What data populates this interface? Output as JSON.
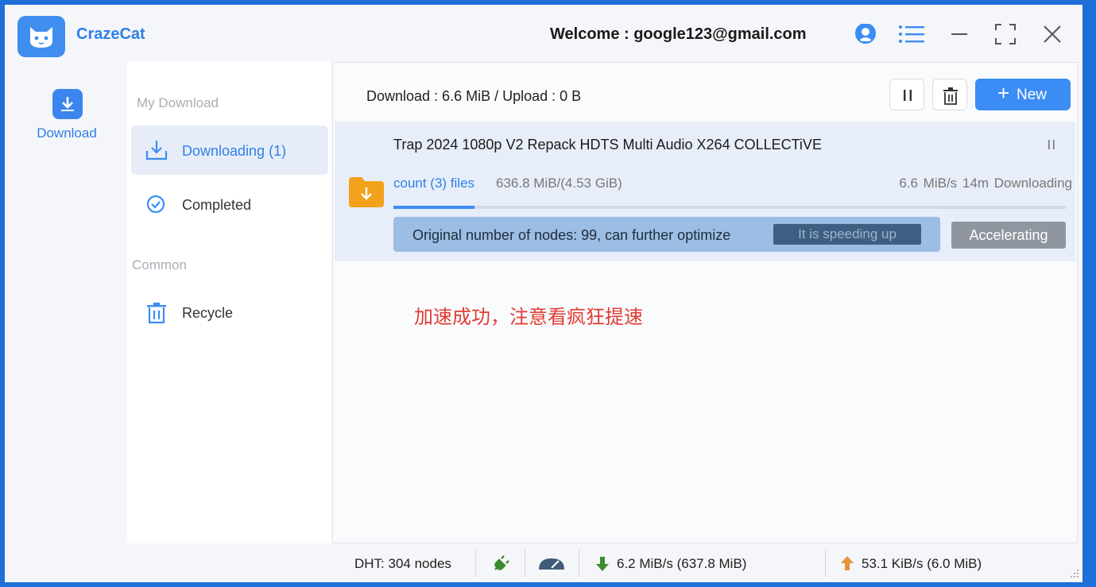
{
  "app": {
    "name": "CrazeCat",
    "welcome": "Welcome : google123@gmail.com"
  },
  "rail": {
    "download_label": "Download"
  },
  "sidebar": {
    "section_my": "My Download",
    "items": [
      {
        "label": "Downloading (1)",
        "active": true
      },
      {
        "label": "Completed"
      }
    ],
    "section_common": "Common",
    "recycle": "Recycle"
  },
  "main": {
    "stats": "Download : 6.6 MiB / Upload : 0 B",
    "new_label": "New"
  },
  "task": {
    "title": "Trap 2024 1080p V2 Repack HDTS Multi Audio X264 COLLECTiVE",
    "files_link": "count (3) files",
    "size": "636.8 MiB/(4.53 GiB)",
    "speed_status": "6.6 MiB/s 14m Downloading",
    "progress": 0.12,
    "accel_text": "Original number of nodes: 99, can further optimize",
    "speeding_badge": "It is speeding up",
    "accel_button": "Accelerating"
  },
  "notice": "加速成功，注意看疯狂提速",
  "statusbar": {
    "dht": "DHT: 304 nodes",
    "down": "6.2 MiB/s (637.8 MiB)",
    "up": "53.1 KiB/s (6.0 MiB)"
  },
  "colors": {
    "accent": "#3b8cf4",
    "notice": "#e23b33",
    "folder": "#f2a21c"
  }
}
